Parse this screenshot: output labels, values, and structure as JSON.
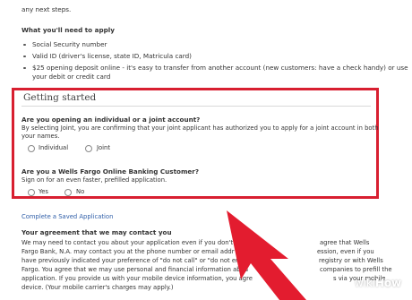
{
  "intro": {
    "top_line": "any next steps."
  },
  "requirements": {
    "title": "What you'll need to apply",
    "items": [
      "Social Security number",
      "Valid ID (driver's license, state ID, Matricula card)",
      "$25 opening deposit online - it's easy to transfer from another account (new customers: have a check handy) or use",
      "your debit or credit card"
    ]
  },
  "getting_started": {
    "title": "Getting started",
    "q1": {
      "question": "Are you opening an individual or a joint account?",
      "help_line1": "By selecting Joint, you are confirming that your joint applicant has authorized you to apply for a joint account in both",
      "help_line2": "your names.",
      "options": [
        "Individual",
        "Joint"
      ]
    },
    "q2": {
      "question": "Are you a Wells Fargo Online Banking Customer?",
      "help": "Sign on for an even faster, prefilled application.",
      "options": [
        "Yes",
        "No"
      ]
    }
  },
  "saved_application": {
    "link": "Complete a Saved Application"
  },
  "agreement": {
    "title": "Your agreement that we may contact you",
    "lines": [
      "We may need to contact you about your application even if you don't",
      "Fargo Bank, N.A. may contact you at the phone number or email addr",
      "have previously indicated your preference of \"do not call\" or \"do not em",
      "Fargo. You agree that we may use personal and financial information abou",
      "application. If you provide us with your mobile device information, you agre",
      "device. (Your mobile carrier's charges may apply.)"
    ],
    "right_fragments": [
      "agree that Wells",
      "ession, even if you",
      "registry or with Wells",
      "companies to prefill the",
      "s via your mobile"
    ]
  },
  "watermark": {
    "wiki": "wiki",
    "how": "How"
  },
  "colors": {
    "panel_border": "#d81f30",
    "arrow": "#e31c2f",
    "link": "#2f5ea8"
  }
}
